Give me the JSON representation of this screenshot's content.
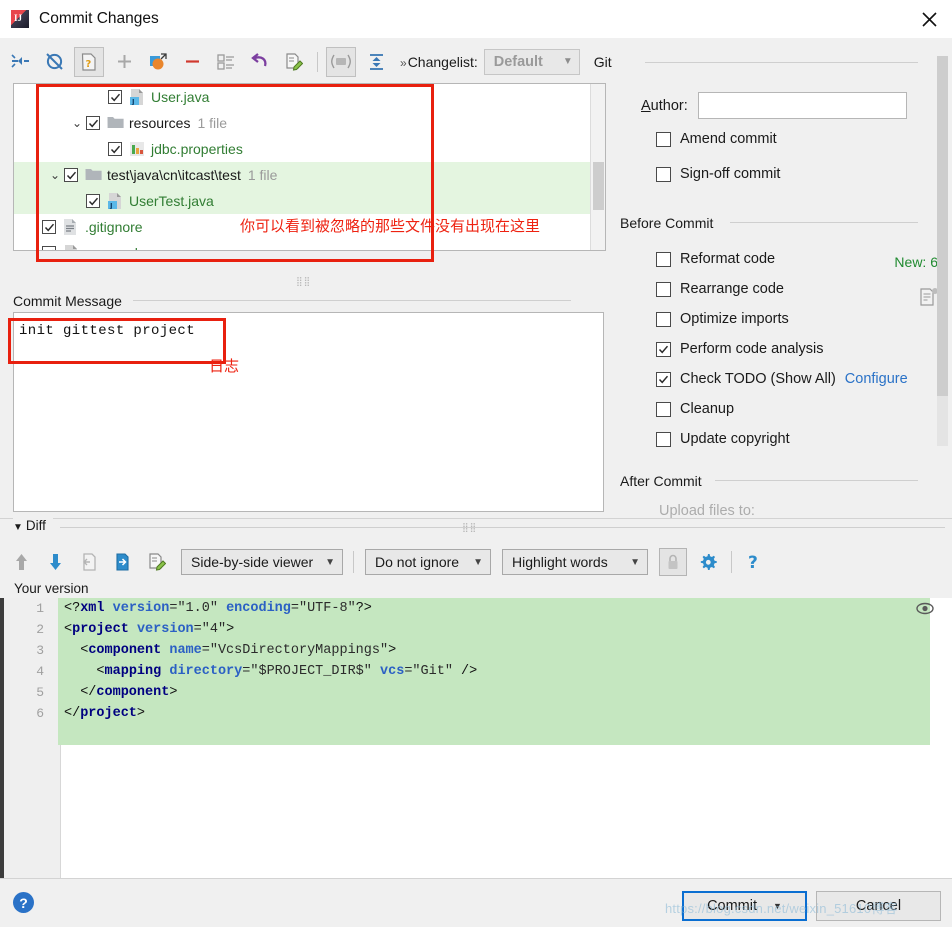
{
  "window": {
    "title": "Commit Changes",
    "logo_icon": "intellij-idea-icon",
    "close_icon": "close-icon"
  },
  "toolbar": {
    "icons": [
      "collapse-all-icon",
      "refresh-changes-icon",
      "show-diff-icon",
      "add-icon",
      "move-to-changelist-icon",
      "remove-icon",
      "group-by-icon",
      "revert-icon",
      "edit-source-icon",
      "show-ignored-icon",
      "expand-collapse-icon"
    ],
    "changelist_label": "Changelist:",
    "changelist_value": "Default",
    "git_label": "Git"
  },
  "file_tree": {
    "rows": [
      {
        "indent": 3,
        "arrow": "",
        "checked": true,
        "icon": "java-file-icon",
        "name": "User.java",
        "meta": "",
        "highlight": false
      },
      {
        "indent": 2,
        "arrow": "v",
        "checked": true,
        "icon": "folder-icon",
        "name": "resources",
        "meta": "1 file",
        "highlight": false
      },
      {
        "indent": 3,
        "arrow": "",
        "checked": true,
        "icon": "properties-file-icon",
        "name": "jdbc.properties",
        "meta": "",
        "highlight": false
      },
      {
        "indent": 1,
        "arrow": "v",
        "checked": true,
        "icon": "folder-icon",
        "name": "test\\java\\cn\\itcast\\test",
        "meta": "1 file",
        "highlight": true
      },
      {
        "indent": 2,
        "arrow": "",
        "checked": true,
        "icon": "java-file-icon",
        "name": "UserTest.java",
        "meta": "",
        "highlight": true
      },
      {
        "indent": 0,
        "arrow": "",
        "checked": true,
        "icon": "text-file-icon",
        "name": ".gitignore",
        "meta": "",
        "highlight": false
      },
      {
        "indent": 0,
        "arrow": "",
        "checked": true,
        "icon": "xml-file-icon",
        "name": "pom.xml",
        "meta": "",
        "highlight": false
      }
    ],
    "new_count": "New: 6"
  },
  "annotations": {
    "tree_note": "你可以看到被忽略的那些文件没有出现在这里",
    "message_note": "日志",
    "box_color": "#e8200f"
  },
  "commit_message": {
    "section_title": "Commit Message",
    "value": "init gittest project",
    "history_icon": "commit-message-history-icon"
  },
  "right_panel": {
    "git_section": "Git",
    "author_label": "Author:",
    "author_value": "",
    "git_options": [
      {
        "label": "Amend commit",
        "checked": false
      },
      {
        "label": "Sign-off commit",
        "checked": false
      }
    ],
    "before_commit_section": "Before Commit",
    "before_commit_options": [
      {
        "label": "Reformat code",
        "checked": false,
        "link": ""
      },
      {
        "label": "Rearrange code",
        "checked": false,
        "link": ""
      },
      {
        "label": "Optimize imports",
        "checked": false,
        "link": ""
      },
      {
        "label": "Perform code analysis",
        "checked": true,
        "link": ""
      },
      {
        "label": "Check TODO (Show All)",
        "checked": true,
        "link": "Configure"
      },
      {
        "label": "Cleanup",
        "checked": false,
        "link": ""
      },
      {
        "label": "Update copyright",
        "checked": false,
        "link": ""
      }
    ],
    "after_commit_section": "After Commit",
    "after_commit_partial": "Upload files to:"
  },
  "diff": {
    "section_title": "Diff",
    "toolbar_icons": [
      "previous-difference-icon",
      "next-difference-icon",
      "accept-left-icon",
      "accept-right-icon",
      "edit-source-icon"
    ],
    "viewer_mode": "Side-by-side viewer",
    "whitespace_mode": "Do not ignore",
    "highlight_mode": "Highlight words",
    "lock_icon": "lock-icon",
    "settings_icon": "gear-icon",
    "help_icon": "question-mark-icon",
    "pane_label": "Your version",
    "preview_icon": "eye-icon",
    "code_lines": [
      {
        "n": "1",
        "segments": [
          {
            "t": "<?",
            "c": "punc"
          },
          {
            "t": "xml",
            "c": "tag"
          },
          {
            "t": " ",
            "c": "punc"
          },
          {
            "t": "version",
            "c": "attr"
          },
          {
            "t": "=\"1.0\" ",
            "c": "str"
          },
          {
            "t": "encoding",
            "c": "attr"
          },
          {
            "t": "=\"UTF-8\"",
            "c": "str"
          },
          {
            "t": "?>",
            "c": "punc"
          }
        ]
      },
      {
        "n": "2",
        "segments": [
          {
            "t": "<",
            "c": "punc"
          },
          {
            "t": "project",
            "c": "tag"
          },
          {
            "t": " ",
            "c": "punc"
          },
          {
            "t": "version",
            "c": "attr"
          },
          {
            "t": "=\"4\"",
            "c": "str"
          },
          {
            "t": ">",
            "c": "punc"
          }
        ]
      },
      {
        "n": "3",
        "segments": [
          {
            "t": "  <",
            "c": "punc"
          },
          {
            "t": "component",
            "c": "tag"
          },
          {
            "t": " ",
            "c": "punc"
          },
          {
            "t": "name",
            "c": "attr"
          },
          {
            "t": "=\"VcsDirectoryMappings\"",
            "c": "str"
          },
          {
            "t": ">",
            "c": "punc"
          }
        ]
      },
      {
        "n": "4",
        "segments": [
          {
            "t": "    <",
            "c": "punc"
          },
          {
            "t": "mapping",
            "c": "tag"
          },
          {
            "t": " ",
            "c": "punc"
          },
          {
            "t": "directory",
            "c": "attr"
          },
          {
            "t": "=\"$PROJECT_DIR$\" ",
            "c": "str"
          },
          {
            "t": "vcs",
            "c": "attr"
          },
          {
            "t": "=\"Git\" ",
            "c": "str"
          },
          {
            "t": "/>",
            "c": "punc"
          }
        ]
      },
      {
        "n": "5",
        "segments": [
          {
            "t": "  </",
            "c": "punc"
          },
          {
            "t": "component",
            "c": "tag"
          },
          {
            "t": ">",
            "c": "punc"
          }
        ]
      },
      {
        "n": "6",
        "segments": [
          {
            "t": "</",
            "c": "punc"
          },
          {
            "t": "project",
            "c": "tag"
          },
          {
            "t": ">",
            "c": "punc"
          }
        ]
      }
    ]
  },
  "footer": {
    "help_icon": "help-icon",
    "commit_label": "Commit",
    "cancel_label": "Cancel",
    "watermark": "https://blog.csdn.net/weixin_51610博客"
  }
}
